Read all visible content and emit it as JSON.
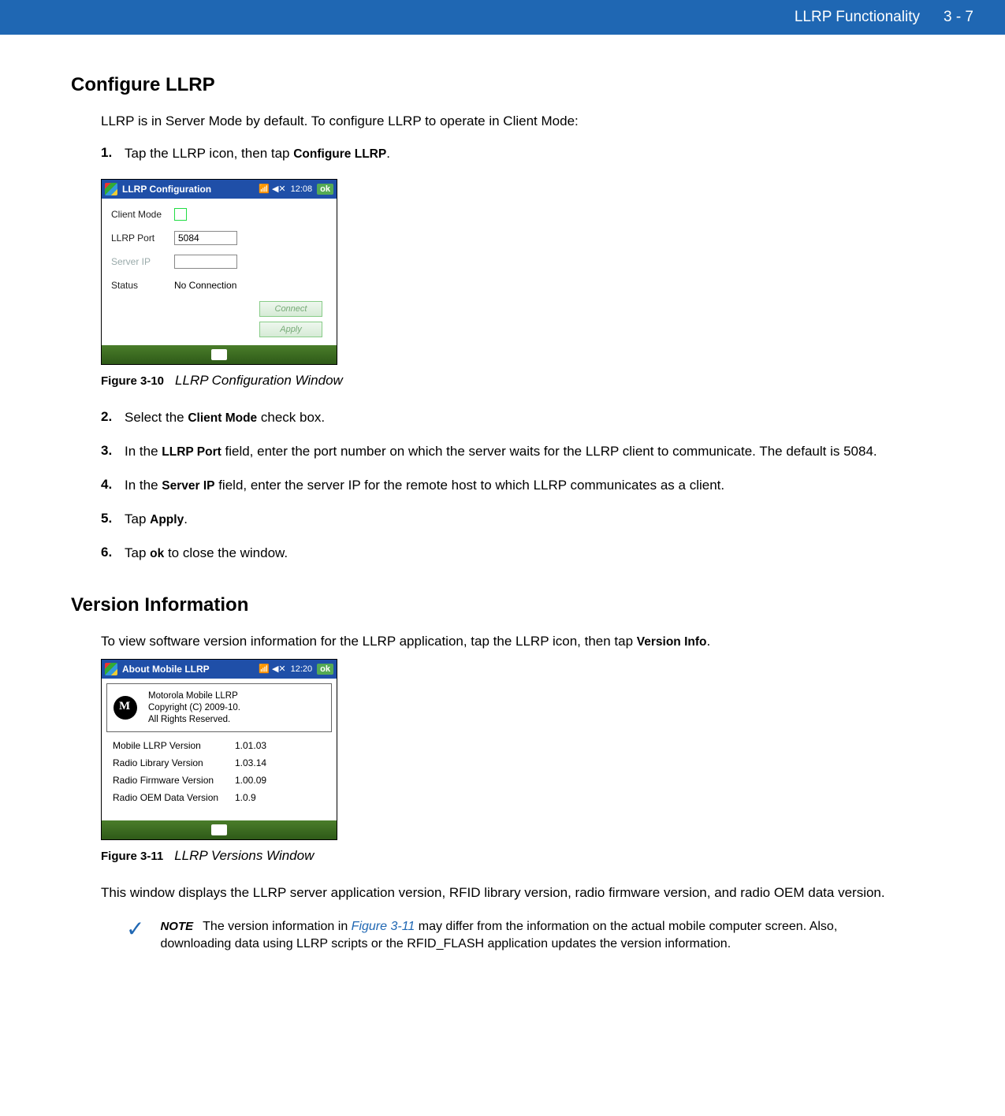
{
  "header": {
    "title": "LLRP Functionality",
    "page": "3 - 7"
  },
  "section1": {
    "heading": "Configure LLRP",
    "intro": "LLRP is in Server Mode by default. To configure LLRP to operate in Client Mode:",
    "steps": {
      "s1_pre": "Tap the LLRP icon, then tap ",
      "s1_bold": "Configure LLRP",
      "s1_post": ".",
      "s2_pre": "Select the ",
      "s2_bold": "Client Mode",
      "s2_post": " check box.",
      "s3_pre": "In the ",
      "s3_bold": "LLRP Port",
      "s3_post": " field, enter the port number on which the server waits for the LLRP client to communicate. The default is 5084.",
      "s4_pre": "In the ",
      "s4_bold": "Server IP",
      "s4_post": " field, enter the server IP for the remote host to which LLRP communicates as a client.",
      "s5_pre": "Tap ",
      "s5_bold": "Apply",
      "s5_post": ".",
      "s6_pre": "Tap ",
      "s6_bold": "ok",
      "s6_post": " to close the window."
    }
  },
  "fig10": {
    "num": "Figure 3-10",
    "title": "LLRP Configuration Window",
    "win": {
      "title": "LLRP Configuration",
      "time": "12:08",
      "ok": "ok",
      "clientmode": "Client Mode",
      "llrpport": "LLRP Port",
      "portval": "5084",
      "serverip": "Server IP",
      "status": "Status",
      "statusval": "No Connection",
      "connect": "Connect",
      "apply": "Apply"
    }
  },
  "section2": {
    "heading": "Version Information",
    "intro_pre": "To view software version information for the LLRP application, tap the LLRP icon, then tap ",
    "intro_bold": "Version Info",
    "intro_post": ".",
    "para": "This window displays the LLRP server application version, RFID library version, radio firmware version, and radio OEM data version."
  },
  "fig11": {
    "num": "Figure 3-11",
    "title": "LLRP Versions Window",
    "win": {
      "title": "About Mobile LLRP",
      "time": "12:20",
      "ok": "ok",
      "line1": "Motorola Mobile LLRP",
      "line2": "Copyright (C) 2009-10.",
      "line3": "All Rights Reserved.",
      "rows": [
        {
          "l": "Mobile LLRP Version",
          "v": "1.01.03"
        },
        {
          "l": "Radio Library Version",
          "v": "1.03.14"
        },
        {
          "l": "Radio Firmware Version",
          "v": "1.00.09"
        },
        {
          "l": "Radio OEM Data Version",
          "v": "1.0.9"
        }
      ]
    }
  },
  "note": {
    "label": "NOTE",
    "pre": "The version information in ",
    "ref": "Figure 3-11",
    "post": " may differ from the information on the actual mobile computer screen. Also, downloading data using LLRP scripts or the RFID_FLASH application updates the version information."
  }
}
